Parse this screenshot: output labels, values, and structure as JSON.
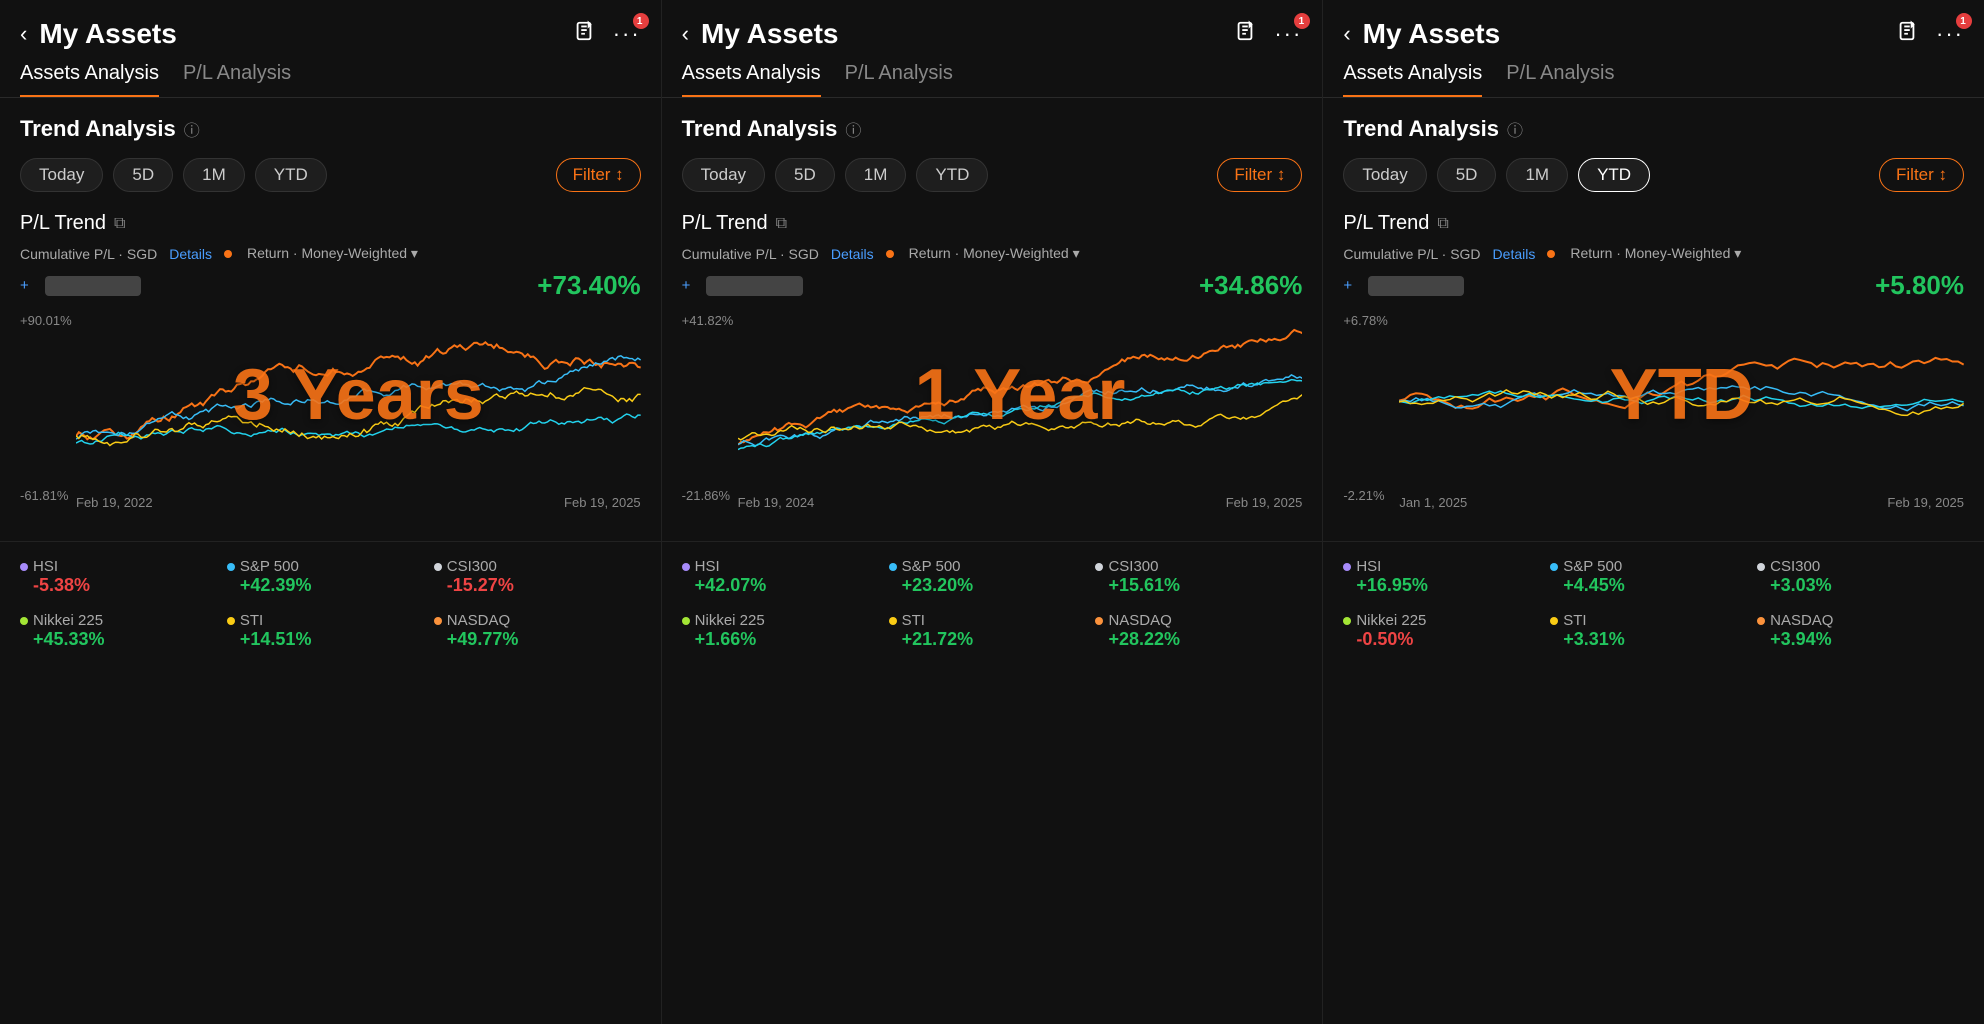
{
  "panels": [
    {
      "id": "panel-3y",
      "header": {
        "title": "My Assets",
        "back_label": "‹",
        "share_icon": "share",
        "more_icon": "···",
        "badge": "1"
      },
      "tabs": [
        {
          "label": "Assets Analysis",
          "active": true
        },
        {
          "label": "P/L Analysis",
          "active": false
        }
      ],
      "section": {
        "title": "Trend Analysis",
        "info": "ⓘ"
      },
      "time_buttons": [
        {
          "label": "Today",
          "active": false
        },
        {
          "label": "5D",
          "active": false
        },
        {
          "label": "1M",
          "active": false
        },
        {
          "label": "YTD",
          "active": false
        }
      ],
      "filter_label": "Filter ↕",
      "pl_trend_label": "P/L Trend",
      "legend": {
        "cumulative_label": "Cumulative P/L · SGD",
        "details_label": "Details",
        "return_label": "Return · Money-Weighted ▾"
      },
      "values": {
        "cumulative_blurred": "████████",
        "return_val": "+73.40%"
      },
      "period_watermark": "3 Years",
      "chart": {
        "y_top": "+90.01%",
        "y_bottom": "-61.81%",
        "x_start": "Feb 19, 2022",
        "x_end": "Feb 19, 2025"
      },
      "indices": [
        {
          "name": "HSI",
          "dot_color": "#a78bfa",
          "value": "-5.38%",
          "positive": false
        },
        {
          "name": "S&P 500",
          "dot_color": "#38bdf8",
          "value": "+42.39%",
          "positive": true
        },
        {
          "name": "CSI300",
          "dot_color": "#d1d5db",
          "value": "-15.27%",
          "positive": false
        },
        {
          "name": "Nikkei 225",
          "dot_color": "#a3e635",
          "value": "+45.33%",
          "positive": true
        },
        {
          "name": "STI",
          "dot_color": "#facc15",
          "value": "+14.51%",
          "positive": true
        },
        {
          "name": "NASDAQ",
          "dot_color": "#fb923c",
          "value": "+49.77%",
          "positive": true
        }
      ]
    },
    {
      "id": "panel-1y",
      "header": {
        "title": "My Assets",
        "back_label": "‹",
        "share_icon": "share",
        "more_icon": "···",
        "badge": "1"
      },
      "tabs": [
        {
          "label": "Assets Analysis",
          "active": true
        },
        {
          "label": "P/L Analysis",
          "active": false
        }
      ],
      "section": {
        "title": "Trend Analysis",
        "info": "ⓘ"
      },
      "time_buttons": [
        {
          "label": "Today",
          "active": false
        },
        {
          "label": "5D",
          "active": false
        },
        {
          "label": "1M",
          "active": false
        },
        {
          "label": "YTD",
          "active": false
        }
      ],
      "filter_label": "Filter ↕",
      "pl_trend_label": "P/L Trend",
      "legend": {
        "cumulative_label": "Cumulative P/L · SGD",
        "details_label": "Details",
        "return_label": "Return · Money-Weighted ▾"
      },
      "values": {
        "cumulative_blurred": "████████",
        "return_val": "+34.86%"
      },
      "period_watermark": "1 Year",
      "chart": {
        "y_top": "+41.82%",
        "y_bottom": "-21.86%",
        "x_start": "Feb 19, 2024",
        "x_end": "Feb 19, 2025"
      },
      "indices": [
        {
          "name": "HSI",
          "dot_color": "#a78bfa",
          "value": "+42.07%",
          "positive": true
        },
        {
          "name": "S&P 500",
          "dot_color": "#38bdf8",
          "value": "+23.20%",
          "positive": true
        },
        {
          "name": "CSI300",
          "dot_color": "#d1d5db",
          "value": "+15.61%",
          "positive": true
        },
        {
          "name": "Nikkei 225",
          "dot_color": "#a3e635",
          "value": "+1.66%",
          "positive": true
        },
        {
          "name": "STI",
          "dot_color": "#facc15",
          "value": "+21.72%",
          "positive": true
        },
        {
          "name": "NASDAQ",
          "dot_color": "#fb923c",
          "value": "+28.22%",
          "positive": true
        }
      ]
    },
    {
      "id": "panel-ytd",
      "header": {
        "title": "My Assets",
        "back_label": "‹",
        "share_icon": "share",
        "more_icon": "···",
        "badge": "1"
      },
      "tabs": [
        {
          "label": "Assets Analysis",
          "active": true
        },
        {
          "label": "P/L Analysis",
          "active": false
        }
      ],
      "section": {
        "title": "Trend Analysis",
        "info": "ⓘ"
      },
      "time_buttons": [
        {
          "label": "Today",
          "active": false
        },
        {
          "label": "5D",
          "active": false
        },
        {
          "label": "1M",
          "active": false
        },
        {
          "label": "YTD",
          "active": true
        }
      ],
      "filter_label": "Filter ↕",
      "pl_trend_label": "P/L Trend",
      "legend": {
        "cumulative_label": "Cumulative P/L · SGD",
        "details_label": "Details",
        "return_label": "Return · Money-Weighted ▾"
      },
      "values": {
        "cumulative_blurred": "████████",
        "return_val": "+5.80%"
      },
      "period_watermark": "YTD",
      "chart": {
        "y_top": "+6.78%",
        "y_bottom": "-2.21%",
        "x_start": "Jan 1, 2025",
        "x_end": "Feb 19, 2025"
      },
      "indices": [
        {
          "name": "HSI",
          "dot_color": "#a78bfa",
          "value": "+16.95%",
          "positive": true
        },
        {
          "name": "S&P 500",
          "dot_color": "#38bdf8",
          "value": "+4.45%",
          "positive": true
        },
        {
          "name": "CSI300",
          "dot_color": "#d1d5db",
          "value": "+3.03%",
          "positive": true
        },
        {
          "name": "Nikkei 225",
          "dot_color": "#a3e635",
          "value": "-0.50%",
          "positive": false
        },
        {
          "name": "STI",
          "dot_color": "#facc15",
          "value": "+3.31%",
          "positive": true
        },
        {
          "name": "NASDAQ",
          "dot_color": "#fb923c",
          "value": "+3.94%",
          "positive": true
        }
      ]
    }
  ]
}
